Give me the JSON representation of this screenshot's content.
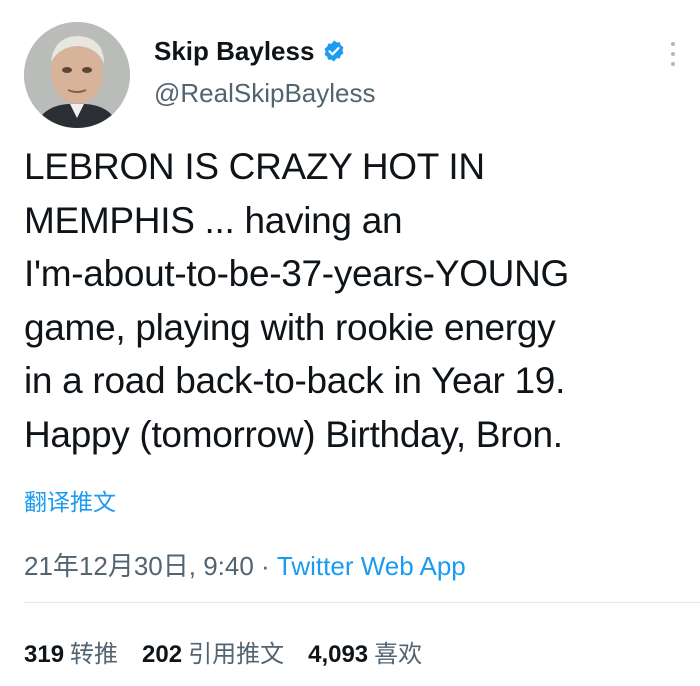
{
  "author": {
    "display_name": "Skip Bayless",
    "handle": "@RealSkipBayless",
    "verified": true,
    "avatar_icon": "profile-photo"
  },
  "tweet": {
    "text": "LEBRON IS CRAZY HOT IN\nMEMPHIS ... having an\nI'm-about-to-be-37-years-YOUNG\ngame, playing with rookie energy\nin a road back-to-back in Year 19.\nHappy (tomorrow) Birthday, Bron.",
    "translate_label": "翻译推文",
    "timestamp": "21年12月30日, 9:40",
    "separator": " · ",
    "source": "Twitter Web App"
  },
  "stats": {
    "retweets_count": "319",
    "retweets_label": "转推",
    "quotes_count": "202",
    "quotes_label": "引用推文",
    "likes_count": "4,093",
    "likes_label": "喜欢"
  },
  "colors": {
    "accent": "#1d9bf0",
    "secondary_text": "#536471",
    "primary_text": "#0f1419"
  }
}
